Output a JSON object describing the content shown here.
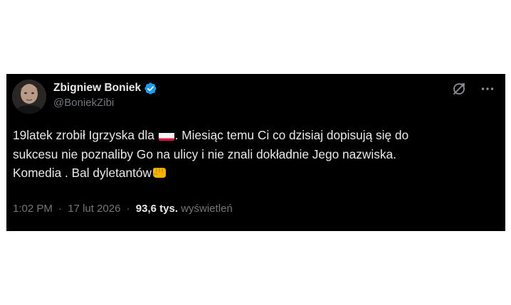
{
  "author": {
    "display_name": "Zbigniew Boniek",
    "handle": "@BoniekZibi",
    "verified": true,
    "verified_color": "#1d9bf0"
  },
  "tweet": {
    "line1_before_flag": "19latek zrobił Igrzyska dla ",
    "flag_icon": "poland-flag-icon",
    "line1_after_flag": ". Miesiąc temu Ci co dzisiaj dopisują się do",
    "line2": "sukcesu nie poznaliby Go na ulicy i nie znali dokładnie Jego nazwiska.",
    "line3": "Komedia . Bal dyletantów",
    "end_icon": "fist-bump-icon"
  },
  "meta": {
    "time": "1:02 PM",
    "separator1": "·",
    "date": "17 lut 2026",
    "separator2": "·",
    "views_count": "93,6 tys.",
    "views_label": "wyświetleń"
  },
  "icons": {
    "grok": "grok-icon",
    "more": "more-icon"
  }
}
